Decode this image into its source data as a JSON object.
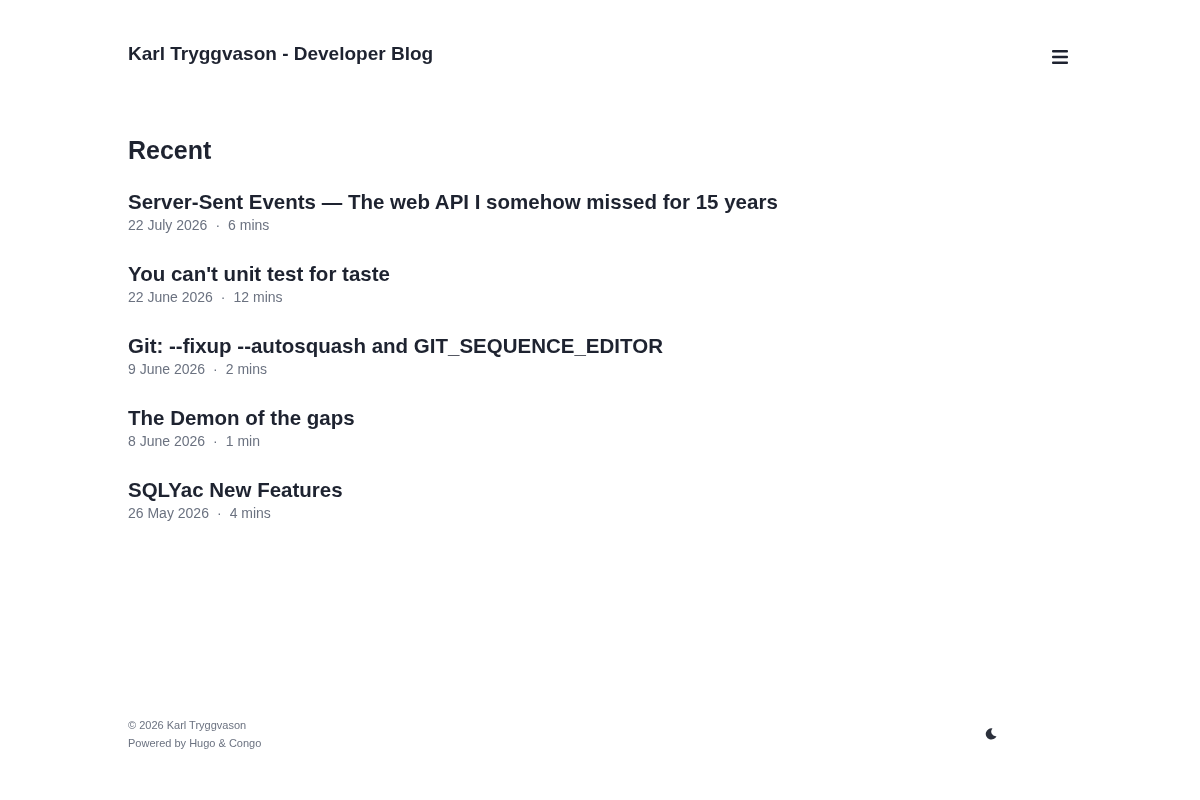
{
  "header": {
    "site_title": "Karl Tryggvason - Developer Blog"
  },
  "section": {
    "heading": "Recent"
  },
  "posts": [
    {
      "title": "Server-Sent Events — The web API I somehow missed for 15 years",
      "date": "22 July 2026",
      "separator": "·",
      "reading_time": "6 mins"
    },
    {
      "title": "You can't unit test for taste",
      "date": "22 June 2026",
      "separator": "·",
      "reading_time": "12 mins"
    },
    {
      "title": "Git: --fixup --autosquash and GIT_SEQUENCE_EDITOR",
      "date": "9 June 2026",
      "separator": "·",
      "reading_time": "2 mins"
    },
    {
      "title": "The Demon of the gaps",
      "date": "8 June 2026",
      "separator": "·",
      "reading_time": "1 min"
    },
    {
      "title": "SQLYac New Features",
      "date": "26 May 2026",
      "separator": "·",
      "reading_time": "4 mins"
    }
  ],
  "footer": {
    "copyright": "© 2026 Karl Tryggvason",
    "powered_by": "Powered by Hugo & Congo"
  }
}
